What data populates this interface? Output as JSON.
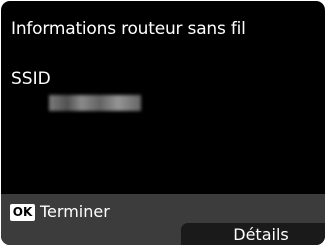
{
  "screen": {
    "title": "Informations routeur sans fil",
    "ssid_label": "SSID"
  },
  "footer": {
    "ok_key": "OK",
    "ok_action": "Terminer",
    "details_label": "Détails"
  }
}
